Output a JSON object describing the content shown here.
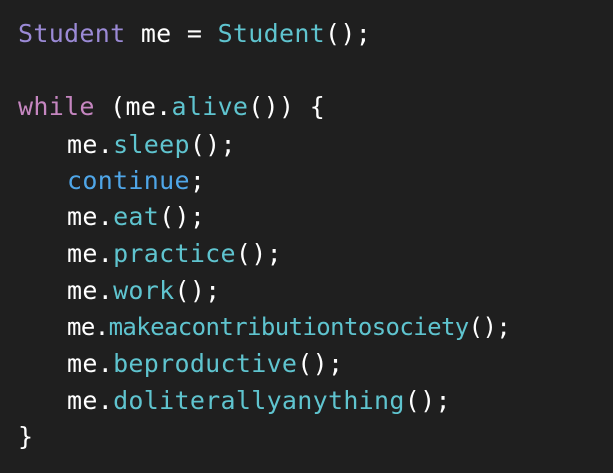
{
  "code": {
    "line1": {
      "type": "Student",
      "var": " me = ",
      "ctor": "Student",
      "end": "();"
    },
    "line3": {
      "kw": "while",
      "open": " (me.",
      "fn": "alive",
      "close": "()) {"
    },
    "body": [
      {
        "obj": "me.",
        "fn": "sleep",
        "end": "();"
      },
      {
        "kw": "continue",
        "end": ";"
      },
      {
        "obj": "me.",
        "fn": "eat",
        "end": "();"
      },
      {
        "obj": "me.",
        "fn": "practice",
        "end": "();"
      },
      {
        "obj": "me.",
        "fn": "work",
        "end": "();"
      },
      {
        "obj": "me.",
        "fn": "makeacontributiontosociety",
        "end": "();"
      },
      {
        "obj": "me.",
        "fn": "beproductive",
        "end": "();"
      },
      {
        "obj": "me.",
        "fn": "doliterallyanything",
        "end": "();"
      }
    ],
    "closing": "}"
  },
  "colors": {
    "background": "#1f1f1f",
    "type": "#9b8ad6",
    "keyword": "#c586c0",
    "control_keyword": "#4fa6e8",
    "function": "#5fc4cf",
    "plain": "#ffffff"
  }
}
